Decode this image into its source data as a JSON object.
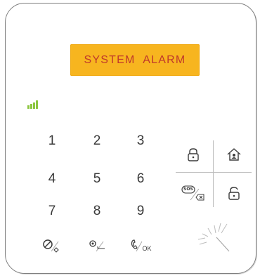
{
  "device": {
    "display_text": "SYSTEM ALARM",
    "colors": {
      "display_bg": "#f7b51f",
      "display_text": "#c0392b",
      "signal": "#8cc63f",
      "frame": "#7f7f7f",
      "key": "#3a3a3a"
    }
  },
  "keypad": {
    "keys": [
      {
        "label": "1",
        "name": "key-1"
      },
      {
        "label": "2",
        "name": "key-2"
      },
      {
        "label": "3",
        "name": "key-3"
      },
      {
        "label": "4",
        "name": "key-4"
      },
      {
        "label": "5",
        "name": "key-5"
      },
      {
        "label": "6",
        "name": "key-6"
      },
      {
        "label": "7",
        "name": "key-7"
      },
      {
        "label": "8",
        "name": "key-8"
      },
      {
        "label": "9",
        "name": "key-9"
      }
    ],
    "bottom_row": {
      "left_icon": "cancel-icon",
      "middle_icon": "settings-icon",
      "right_label": "OK",
      "right_icon": "handset-icon"
    }
  },
  "side_panel": {
    "top_left_icon": "lock-icon",
    "top_right_icon": "home-arm-icon",
    "bottom_left_label": "SOS",
    "bottom_left_icon": "backspace-icon",
    "bottom_right_icon": "unlock-icon"
  },
  "signal_icon": "signal-strength-icon",
  "card_reader_icon": "card-tap-icon"
}
